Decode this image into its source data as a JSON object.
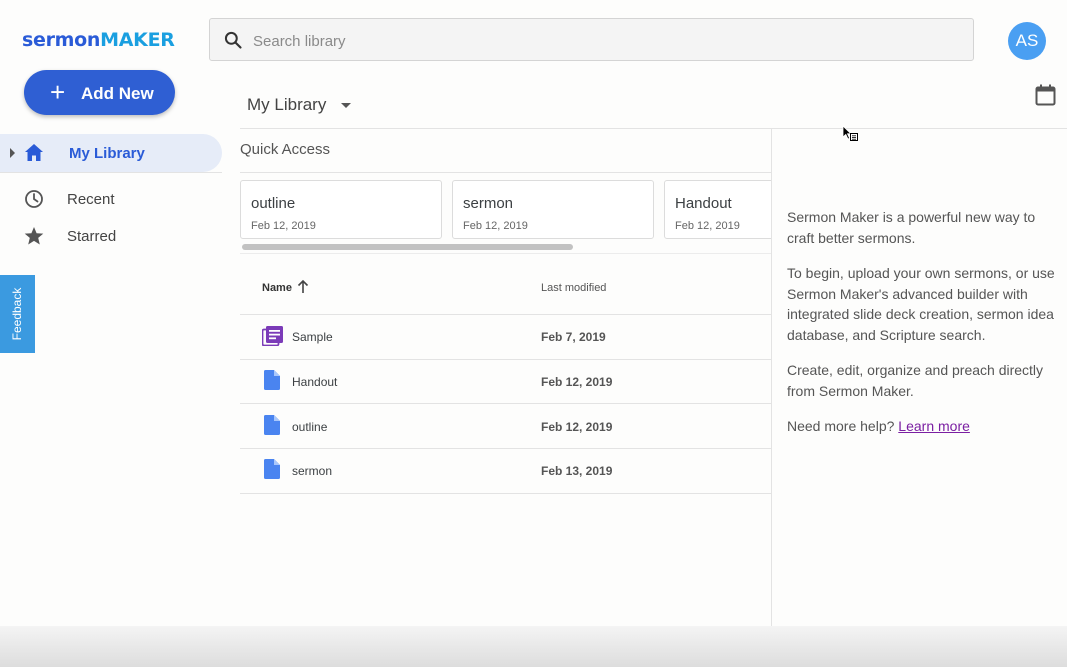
{
  "brand": {
    "part1": "sermon",
    "part2": "MAKER",
    "color1": "#2a5bd7",
    "color2": "#1a9fe0"
  },
  "search": {
    "placeholder": "Search library",
    "value": ""
  },
  "user": {
    "initials": "AS",
    "avatar_color": "#4a9ff2"
  },
  "add_new": {
    "label": "Add New",
    "icon": "plus-icon"
  },
  "sidebar": {
    "items": [
      {
        "label": "My Library",
        "icon": "home-icon",
        "active": true
      },
      {
        "label": "Recent",
        "icon": "clock-icon",
        "active": false
      },
      {
        "label": "Starred",
        "icon": "star-icon",
        "active": false
      }
    ]
  },
  "feedback": {
    "label": "Feedback"
  },
  "header": {
    "title": "My Library",
    "calendar_icon": "calendar-icon"
  },
  "quick_access": {
    "title": "Quick Access",
    "cards": [
      {
        "name": "outline",
        "date": "Feb 12, 2019"
      },
      {
        "name": "sermon",
        "date": "Feb 12, 2019"
      },
      {
        "name": "Handout",
        "date": "Feb 12, 2019"
      }
    ]
  },
  "table": {
    "columns": {
      "name": "Name",
      "modified": "Last modified"
    },
    "sort": {
      "column": "name",
      "direction": "ascending"
    },
    "rows": [
      {
        "name": "Sample",
        "modified": "Feb 7, 2019",
        "icon": "slides-icon",
        "icon_color": "#7b3bb8"
      },
      {
        "name": "Handout",
        "modified": "Feb 12, 2019",
        "icon": "document-icon",
        "icon_color": "#4a84f0"
      },
      {
        "name": "outline",
        "modified": "Feb 12, 2019",
        "icon": "document-icon",
        "icon_color": "#4a84f0"
      },
      {
        "name": "sermon",
        "modified": "Feb 13, 2019",
        "icon": "document-icon",
        "icon_color": "#4a84f0"
      }
    ]
  },
  "info": {
    "p1": "Sermon Maker is a powerful new way to craft better sermons.",
    "p2": "To begin, upload your own sermons, or use Sermon Maker's advanced builder with integrated slide deck creation, sermon idea database, and Scripture search.",
    "p3": "Create, edit, organize and preach directly from Sermon Maker.",
    "help_prefix": "Need more help?",
    "help_link": "Learn more"
  }
}
